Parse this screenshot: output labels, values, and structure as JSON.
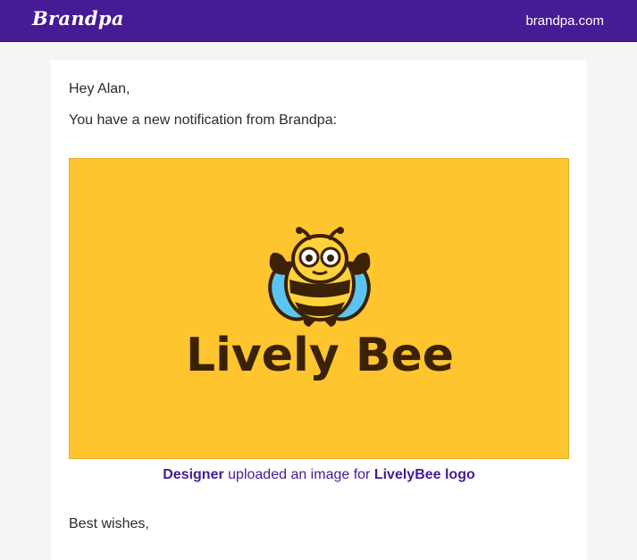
{
  "header": {
    "brand": "Brandpa",
    "site_link": "brandpa.com",
    "background_color": "#471a96"
  },
  "email": {
    "greeting": "Hey Alan,",
    "intro": "You have a new notification from Brandpa:",
    "preview_image": {
      "wordmark": "Lively Bee",
      "background_color": "#fec52f",
      "icon": "bee-mascot-icon"
    },
    "caption": {
      "actor": "Designer",
      "action": " uploaded an image for ",
      "target": "LivelyBee logo"
    },
    "signoff": "Best wishes,"
  }
}
